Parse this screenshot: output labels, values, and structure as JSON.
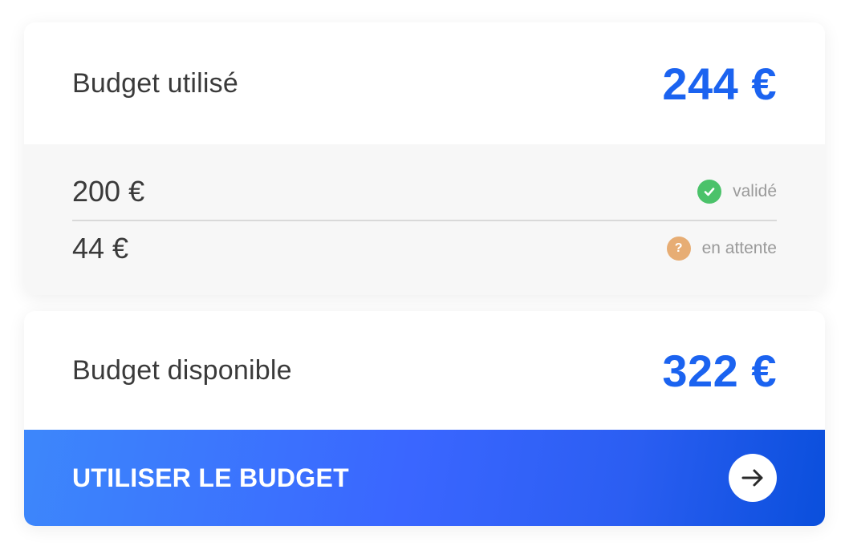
{
  "used": {
    "label": "Budget utilisé",
    "amount": "244 €",
    "items": [
      {
        "amount": "200 €",
        "status": "validé",
        "status_icon": "check-circle-icon",
        "status_color": "#4bc26a"
      },
      {
        "amount": "44 €",
        "status": "en attente",
        "status_icon": "question-circle-icon",
        "status_color": "#e7ad74"
      }
    ]
  },
  "available": {
    "label": "Budget disponible",
    "amount": "322 €"
  },
  "cta": {
    "label": "UTILISER LE BUDGET",
    "icon": "arrow-right-icon"
  },
  "colors": {
    "accent": "#1b63f0"
  }
}
